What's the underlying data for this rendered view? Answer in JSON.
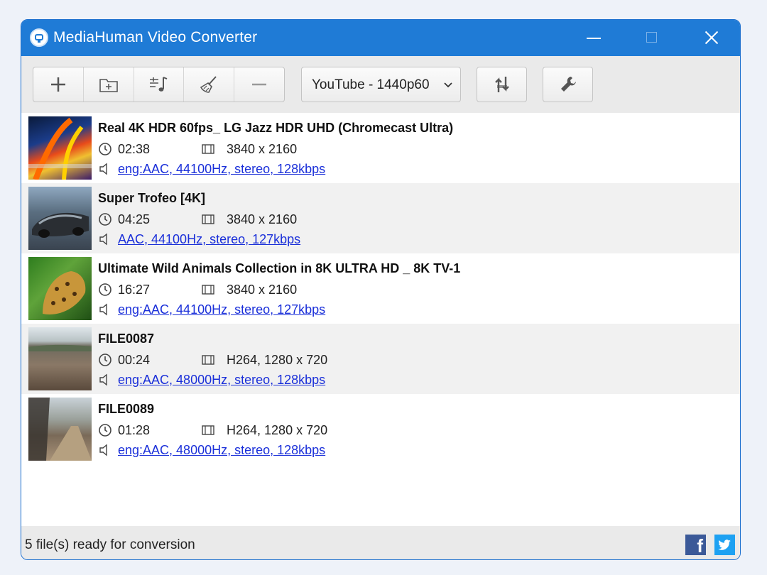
{
  "window": {
    "title": "MediaHuman Video Converter"
  },
  "toolbar": {
    "buttons": [
      "add-files",
      "add-folder",
      "add-audio-track",
      "clear-list",
      "remove-item"
    ],
    "format_selected": "YouTube - 1440p60"
  },
  "files": [
    {
      "title": "Real 4K HDR 60fps_ LG Jazz HDR UHD (Chromecast Ultra)",
      "duration": "02:38",
      "resolution": "3840 x 2160",
      "audio": "eng:AAC, 44100Hz, stereo, 128kbps"
    },
    {
      "title": "Super Trofeo [4K]",
      "duration": "04:25",
      "resolution": "3840 x 2160",
      "audio": "AAC, 44100Hz, stereo, 127kbps"
    },
    {
      "title": "Ultimate Wild Animals Collection in 8K ULTRA HD _ 8K TV-1",
      "duration": "16:27",
      "resolution": "3840 x 2160",
      "audio": "eng:AAC, 44100Hz, stereo, 127kbps"
    },
    {
      "title": "FILE0087",
      "duration": "00:24",
      "resolution": "H264, 1280 x 720",
      "audio": "eng:AAC, 48000Hz, stereo, 128kbps"
    },
    {
      "title": "FILE0089",
      "duration": "01:28",
      "resolution": "H264, 1280 x 720",
      "audio": "eng:AAC, 48000Hz, stereo, 128kbps"
    }
  ],
  "status": {
    "text": "5 file(s) ready for conversion"
  },
  "colors": {
    "titlebar": "#1f7bd6",
    "link": "#1a2fd9",
    "facebook": "#3b5998",
    "twitter": "#1da1f2"
  }
}
